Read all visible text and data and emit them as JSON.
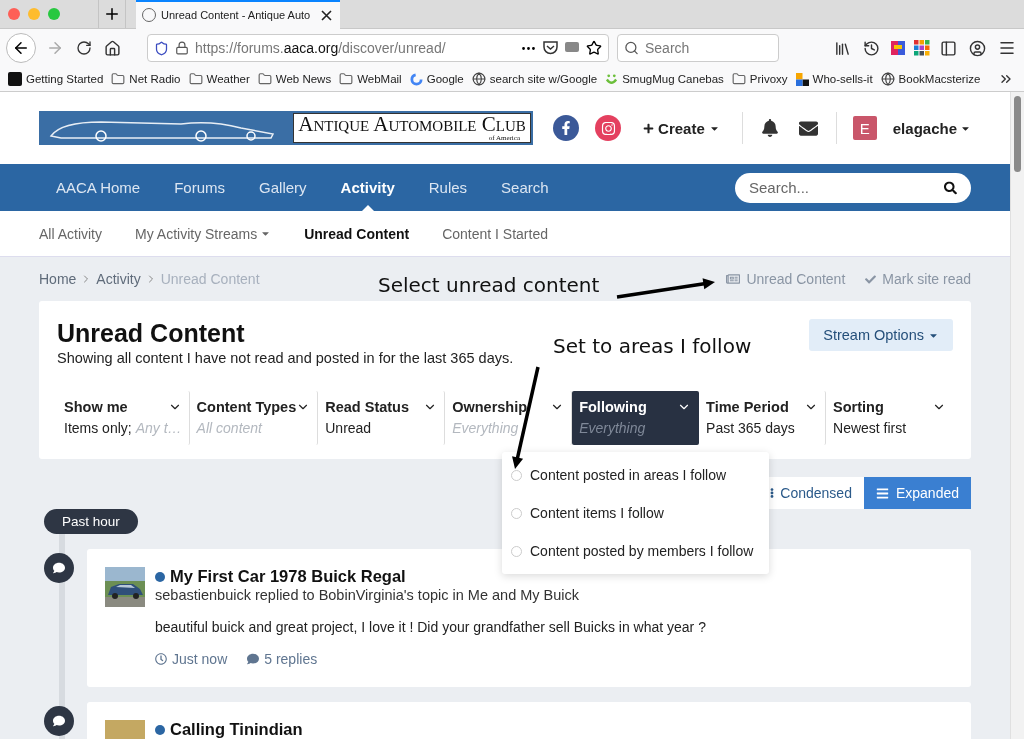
{
  "browser": {
    "tab_title": "Unread Content - Antique Auto",
    "url": {
      "scheme": "https://forums.",
      "domain": "aaca.org",
      "path": "/discover/unread/"
    },
    "search_placeholder": "Search",
    "bookmarks": [
      {
        "label": "Getting Started",
        "kind": "m"
      },
      {
        "label": "Net Radio",
        "kind": "folder"
      },
      {
        "label": "Weather",
        "kind": "folder"
      },
      {
        "label": "Web News",
        "kind": "folder"
      },
      {
        "label": "WebMail",
        "kind": "folder"
      },
      {
        "label": "Google",
        "kind": "google"
      },
      {
        "label": "search site w/Google",
        "kind": "globe"
      },
      {
        "label": "SmugMug Canebas",
        "kind": "smug"
      },
      {
        "label": "Privoxy",
        "kind": "folder"
      },
      {
        "label": "Who-sells-it",
        "kind": "squares"
      },
      {
        "label": "BookMacsterize",
        "kind": "globe"
      }
    ]
  },
  "site": {
    "logo": {
      "name": "Antique Automobile Club",
      "sub": "of America"
    },
    "create": "Create",
    "user": {
      "initial": "E",
      "name": "elagache"
    },
    "nav": [
      {
        "label": "AACA Home",
        "selected": false
      },
      {
        "label": "Forums",
        "selected": false
      },
      {
        "label": "Gallery",
        "selected": false
      },
      {
        "label": "Activity",
        "selected": true
      },
      {
        "label": "Rules",
        "selected": false
      },
      {
        "label": "Search",
        "selected": false
      }
    ],
    "search_placeholder": "Search...",
    "subnav": [
      {
        "label": "All Activity",
        "selected": false,
        "dropdown": false
      },
      {
        "label": "My Activity Streams",
        "selected": false,
        "dropdown": true
      },
      {
        "label": "Unread Content",
        "selected": true,
        "dropdown": false
      },
      {
        "label": "Content I Started",
        "selected": false,
        "dropdown": false
      }
    ]
  },
  "breadcrumbs": [
    "Home",
    "Activity",
    "Unread Content"
  ],
  "page_actions": [
    {
      "label": "Unread Content",
      "kind": "unread"
    },
    {
      "label": "Mark site read",
      "kind": "check"
    }
  ],
  "stream": {
    "title": "Unread Content",
    "description": "Showing all content I have not read and posted in for the last 365 days.",
    "options_button": "Stream Options",
    "filters": [
      {
        "label": "Show me",
        "value": "Items only;",
        "hint": "Any t…",
        "selected": false
      },
      {
        "label": "Content Types",
        "hint": "All content",
        "selected": false
      },
      {
        "label": "Read Status",
        "value": "Unread",
        "selected": false
      },
      {
        "label": "Ownership",
        "hint": "Everything",
        "selected": false
      },
      {
        "label": "Following",
        "hint": "Everything",
        "selected": true
      },
      {
        "label": "Time Period",
        "value": "Past 365 days",
        "selected": false
      },
      {
        "label": "Sorting",
        "value": "Newest first",
        "selected": false
      }
    ],
    "following_menu": [
      {
        "label": "Content posted in areas I follow",
        "selected": false
      },
      {
        "label": "Content items I follow",
        "selected": false
      },
      {
        "label": "Content posted by members I follow",
        "selected": false
      }
    ],
    "views": [
      {
        "label": "Condensed",
        "selected": false,
        "kind": "condensed"
      },
      {
        "label": "Expanded",
        "selected": true,
        "kind": "expanded"
      }
    ],
    "period": "Past hour",
    "items": [
      {
        "title": "My First Car 1978 Buick Regal",
        "unread": true,
        "meta": "sebastienbuick replied to BobinVirginia's topic in Me and My Buick",
        "snippet": "beautiful buick and great project, I love it ! Did your grandfather sell Buicks in what year ?",
        "time": "Just now",
        "replies": "5 replies"
      },
      {
        "title": "Calling Tinindian",
        "unread": true,
        "avatar": {
          "kind": "letter",
          "color": "#c4a862"
        }
      }
    ]
  },
  "annotations": [
    "Select unread content",
    "Set to areas I follow"
  ]
}
